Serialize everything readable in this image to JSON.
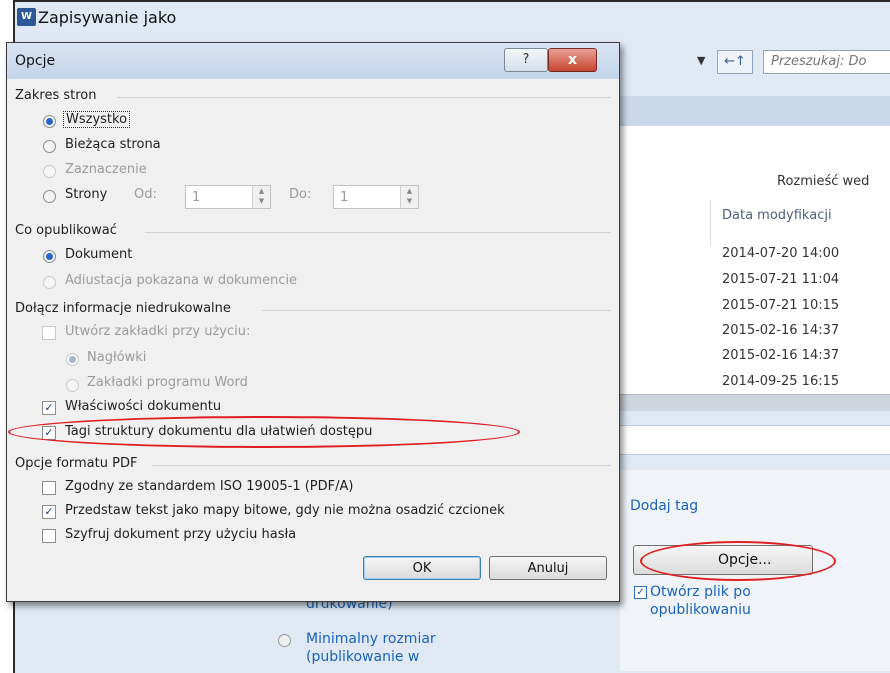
{
  "background_window": {
    "title": "Zapisywanie jako",
    "word_icon": "W",
    "search_placeholder": "Przeszukaj: Do",
    "nav_icon": "←↑",
    "arrange_label": "Rozmieść wed",
    "date_column": "Data modyfikacji",
    "dates": [
      "2014-07-20 14:00",
      "2015-07-21 11:04",
      "2015-07-21 10:15",
      "2015-02-16 14:37",
      "2015-02-16 14:37",
      "2014-09-25 16:15"
    ],
    "add_tag": "Dodaj tag",
    "options_button": "Opcje...",
    "open_after_publish": "Otwórz plik po opublikowaniu",
    "print_partial": "drukowanie)",
    "min_size": "Minimalny rozmiar (publikowanie w"
  },
  "dialog": {
    "title": "Opcje",
    "help_icon": "?",
    "close_icon": "x",
    "page_range": {
      "heading": "Zakres stron",
      "all": "Wszystko",
      "current": "Bieżąca strona",
      "selection": "Zaznaczenie",
      "pages": "Strony",
      "from_label": "Od:",
      "from_value": "1",
      "to_label": "Do:",
      "to_value": "1"
    },
    "publish_what": {
      "heading": "Co opublikować",
      "document": "Dokument",
      "markup": "Adiustacja pokazana w dokumencie"
    },
    "non_printing": {
      "heading": "Dołącz informacje niedrukowalne",
      "create_bookmarks": "Utwórz zakładki przy użyciu:",
      "headings": "Nagłówki",
      "word_bookmarks": "Zakładki programu Word",
      "doc_properties": "Właściwości dokumentu",
      "structure_tags": "Tagi struktury dokumentu dla ułatwień dostępu"
    },
    "pdf_options": {
      "heading": "Opcje formatu PDF",
      "iso": "Zgodny ze standardem ISO 19005-1 (PDF/A)",
      "bitmap": "Przedstaw tekst jako mapy bitowe, gdy nie można osadzić czcionek",
      "encrypt": "Szyfruj dokument przy użyciu hasła"
    },
    "ok": "OK",
    "cancel": "Anuluj"
  },
  "checked": {
    "doc_properties": true,
    "structure_tags": true,
    "bitmap": true,
    "iso": false,
    "encrypt": false,
    "open_after_publish": true
  },
  "colors": {
    "accent": "#2766c9",
    "annotation": "#e02020",
    "link": "#1a63b8"
  }
}
